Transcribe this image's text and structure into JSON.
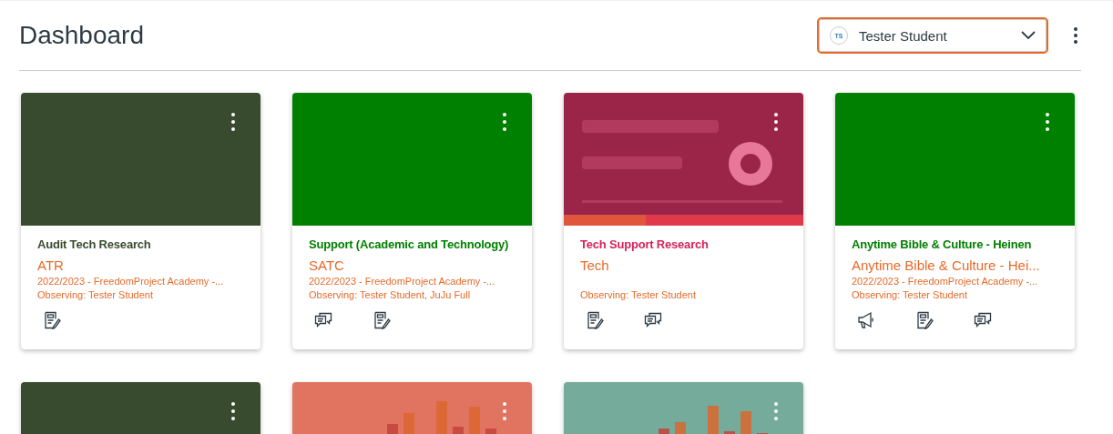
{
  "page": {
    "title": "Dashboard"
  },
  "observer_select": {
    "avatar_initials": "TS",
    "value": "Tester Student"
  },
  "cards": [
    {
      "header": {
        "kind": "color"
      },
      "color": "#394b2e",
      "title": "Audit Tech Research",
      "code": "ATR",
      "term": "2022/2023 - FreedomProject Academy -...",
      "observing": "Observing: Tester Student",
      "icons": [
        {
          "kind": "assignments"
        }
      ]
    },
    {
      "header": {
        "kind": "color"
      },
      "color": "#008000",
      "title": "Support (Academic and Technology)",
      "code": "SATC",
      "term": "2022/2023 - FreedomProject Academy -...",
      "observing": "Observing: Tester Student, JuJu Full",
      "icons": [
        {
          "kind": "discussions"
        },
        {
          "kind": "assignments"
        }
      ]
    },
    {
      "header": {
        "kind": "banner"
      },
      "color": "#d3245a",
      "title": "Tech Support Research",
      "code": "Tech",
      "observing": "Observing: Tester Student",
      "icons": [
        {
          "kind": "assignments"
        },
        {
          "kind": "discussions"
        }
      ]
    },
    {
      "header": {
        "kind": "color"
      },
      "color": "#008000",
      "title": "Anytime Bible & Culture - Heinen",
      "code": "Anytime Bible & Culture - Hei...",
      "term": "2022/2023 - FreedomProject Academy -...",
      "observing": "Observing: Tester Student",
      "icons": [
        {
          "kind": "announcements"
        },
        {
          "kind": "assignments"
        },
        {
          "kind": "discussions"
        }
      ]
    },
    {
      "header": {
        "kind": "color"
      },
      "color": "#394b2e"
    },
    {
      "header": {
        "kind": "bars"
      }
    },
    {
      "header": {
        "kind": "bars"
      }
    }
  ]
}
